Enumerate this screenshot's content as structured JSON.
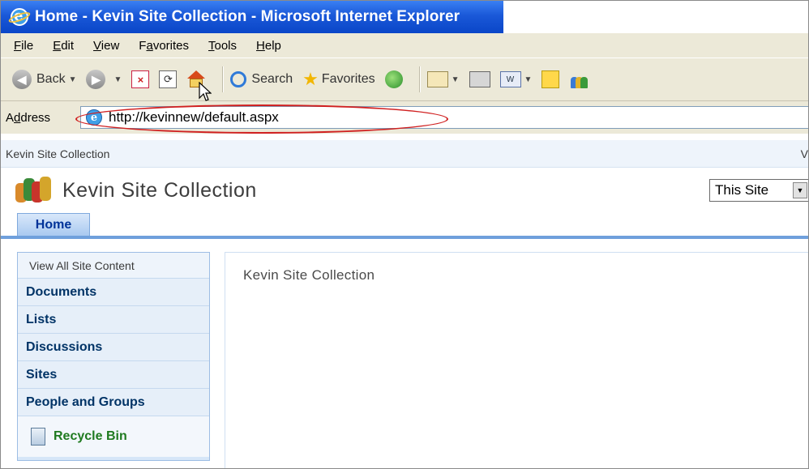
{
  "window": {
    "title": "Home - Kevin Site Collection - Microsoft Internet Explorer"
  },
  "menubar": {
    "items": [
      {
        "first": "F",
        "rest": "ile"
      },
      {
        "first": "E",
        "rest": "dit"
      },
      {
        "first": "V",
        "rest": "iew"
      },
      {
        "first": "F",
        "pre": "F",
        "u": "a",
        "post": "vorites"
      },
      {
        "first": "T",
        "rest": "ools"
      },
      {
        "first": "H",
        "rest": "elp"
      }
    ]
  },
  "toolbar": {
    "back_label": "Back",
    "search_label": "Search",
    "favorites_label": "Favorites"
  },
  "address": {
    "label_pre": "A",
    "label_u": "d",
    "label_post": "dress",
    "url": "http://kevinnew/default.aspx"
  },
  "sharepoint": {
    "top_bar_title": "Kevin Site Collection",
    "top_bar_right_fragment": "V",
    "site_title": "Kevin Site Collection",
    "search_scope": "This Site",
    "tab_home": "Home",
    "quick_launch": {
      "view_all": "View All Site Content",
      "items": [
        "Documents",
        "Lists",
        "Discussions",
        "Sites",
        "People and Groups"
      ],
      "recycle_bin": "Recycle Bin"
    },
    "content_text": "Kevin Site Collection"
  },
  "colors": {
    "titlebar_blue": "#0a46c8",
    "annotation_red": "#d02020",
    "tab_border_blue": "#6fa0dc",
    "recycle_green": "#1f7a1f"
  }
}
